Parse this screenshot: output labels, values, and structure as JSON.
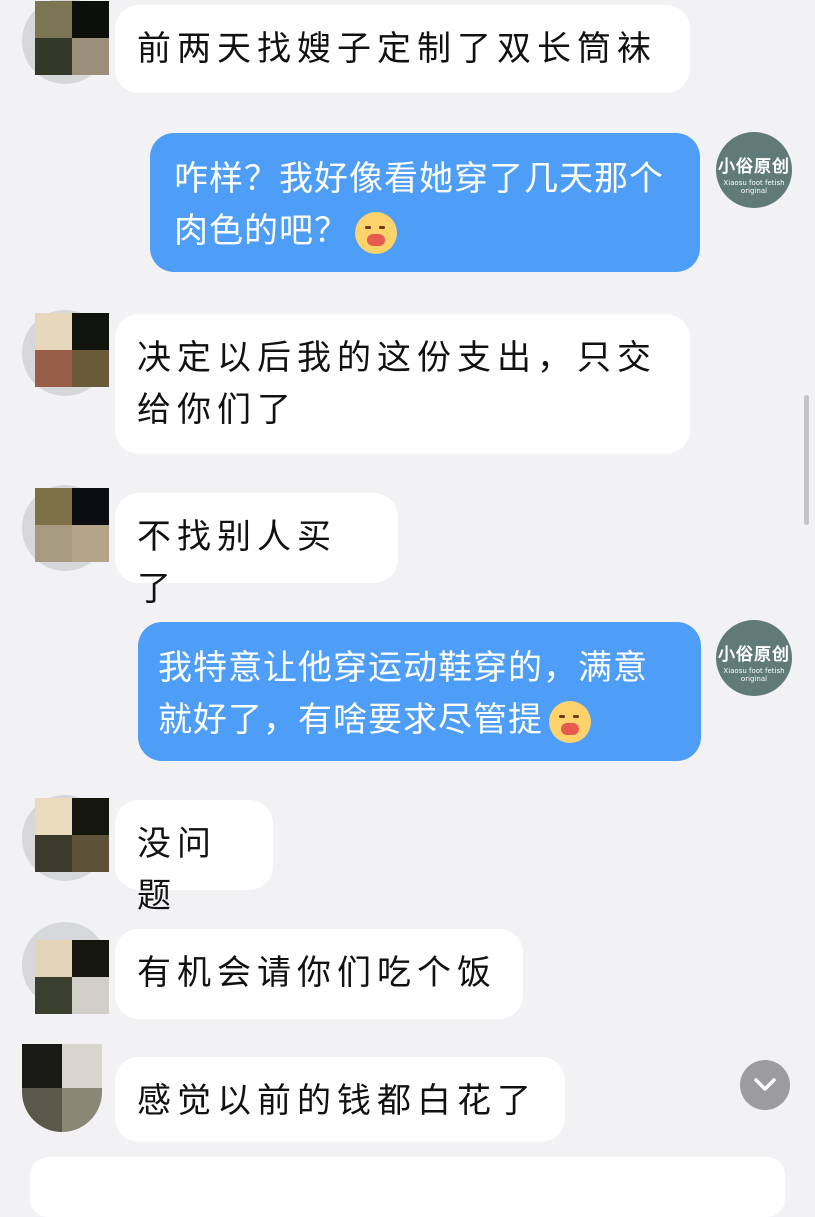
{
  "messages": [
    {
      "side": "in",
      "text": "前两天找嫂子定制了双长筒袜"
    },
    {
      "side": "out",
      "text": "咋样？我好像看她穿了几天那个肉色的吧？",
      "emoji": "drooling-face-emoji"
    },
    {
      "side": "in",
      "text": "决定以后我的这份支出，只交给你们了"
    },
    {
      "side": "in",
      "text": "不找别人买了"
    },
    {
      "side": "out",
      "text": "我特意让他穿运动鞋穿的，满意就好了，有啥要求尽管提",
      "emoji": "drooling-face-emoji"
    },
    {
      "side": "in",
      "text": "没问题"
    },
    {
      "side": "in",
      "text": "有机会请你们吃个饭"
    },
    {
      "side": "in",
      "text": "感觉以前的钱都白花了"
    }
  ],
  "brand_avatar": {
    "title": "小俗原创",
    "subtitle": "Xiaosu foot fetish original"
  },
  "colors": {
    "outgoing_bubble": "#4e9ef7",
    "incoming_bubble": "#ffffff",
    "background": "#f2f2f4"
  }
}
